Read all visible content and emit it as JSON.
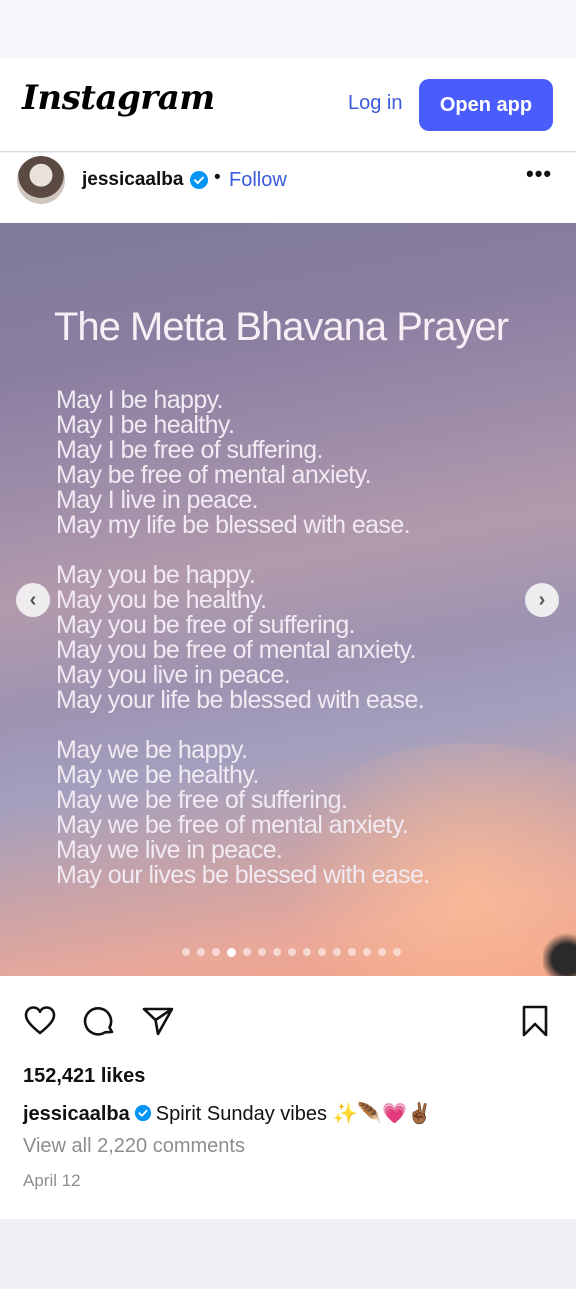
{
  "header": {
    "logo": "Instagram",
    "login_label": "Log in",
    "open_app_label": "Open app"
  },
  "post": {
    "username": "jessicaalba",
    "separator": "•",
    "follow_label": "Follow",
    "more_label": "•••",
    "image": {
      "title": "The Metta Bhavana Prayer",
      "stanzas": [
        [
          "May I be happy.",
          "May I be healthy.",
          "May I be free of suffering.",
          "May be free of mental anxiety.",
          "May I live in peace.",
          "May my life be blessed with ease."
        ],
        [
          "May you be happy.",
          "May you be healthy.",
          "May you be free of suffering.",
          "May you be free of mental anxiety.",
          "May you live in peace.",
          "May your life be blessed with ease."
        ],
        [
          "May we be happy.",
          "May we be healthy.",
          "May we be free of suffering.",
          "May we be free of mental anxiety.",
          "May we live in peace.",
          "May our lives be blessed with ease."
        ]
      ],
      "carousel": {
        "total": 15,
        "active_index": 4
      },
      "prev_label": "‹",
      "next_label": "›"
    },
    "likes": "152,421 likes",
    "caption_user": "jessicaalba",
    "caption_text": "Spirit Sunday vibes ✨🪶💗✌🏾",
    "view_comments": "View all 2,220 comments",
    "date": "April 12"
  },
  "colors": {
    "accent": "#4a5dfc",
    "link": "#3b5bdb",
    "verified": "#0095f6",
    "muted": "#8e8e8e"
  }
}
